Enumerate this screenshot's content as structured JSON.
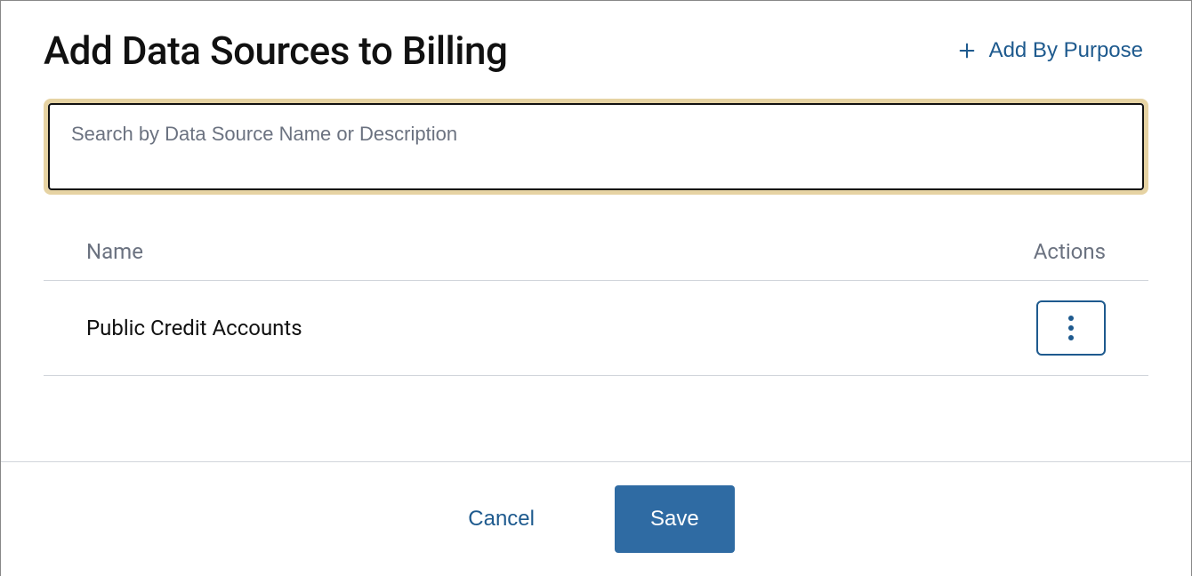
{
  "header": {
    "title": "Add Data Sources to Billing",
    "add_by_purpose_label": "Add By Purpose"
  },
  "search": {
    "placeholder": "Search by Data Source Name or Description",
    "value": ""
  },
  "table": {
    "columns": {
      "name": "Name",
      "actions": "Actions"
    },
    "rows": [
      {
        "name": "Public Credit Accounts"
      }
    ]
  },
  "footer": {
    "cancel_label": "Cancel",
    "save_label": "Save"
  }
}
